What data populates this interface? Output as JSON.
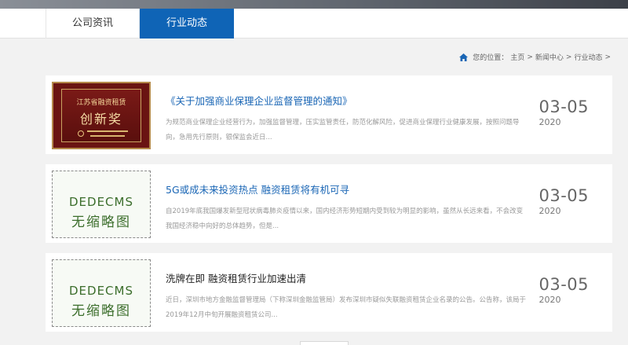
{
  "tabs": [
    {
      "label": "公司资讯"
    },
    {
      "label": "行业动态"
    }
  ],
  "breadcrumb": {
    "prefix": "您的位置：",
    "items": [
      "主页",
      "新闻中心",
      "行业动态"
    ],
    "separator": ">",
    "trailing": ">"
  },
  "articles": [
    {
      "thumb_type": "award-plaque",
      "plaque_line1": "江苏省融资租赁",
      "plaque_line2": "创新奖",
      "title": "《关于加强商业保理企业监督管理的通知》",
      "summary": "为规范商业保理企业经营行为，加强监督管理，压实监管责任，防范化解风险，促进商业保理行业健康发展，按照问题导向，急用先行原则，银保监会近日...",
      "date_md": "03-05",
      "year": "2020"
    },
    {
      "thumb_type": "no-image",
      "thumb_line1": "DEDECMS",
      "thumb_line2": "无缩略图",
      "title": "5G或成未来投资热点 融资租赁将有机可寻",
      "summary": "自2019年底我国爆发新型冠状病毒肺炎疫情以来，国内经济形势短期内受到较为明显的影响，虽然从长远来看，不会改变我国经济稳中向好的总体趋势，但是...",
      "date_md": "03-05",
      "year": "2020"
    },
    {
      "thumb_type": "no-image",
      "thumb_line1": "DEDECMS",
      "thumb_line2": "无缩略图",
      "title": "洗牌在即 融资租赁行业加速出清",
      "summary": "近日，深圳市地方金融监督管理局（下称深圳金融监管局）发布深圳市疑似失联融资租赁企业名录的公告。公告称，该局于2019年12月中旬开展融资租赁公司...",
      "date_md": "03-05",
      "year": "2020"
    }
  ],
  "colors": {
    "accent": "#0f64b6",
    "title_link": "#1a66b5",
    "background": "#f2f2f2"
  }
}
